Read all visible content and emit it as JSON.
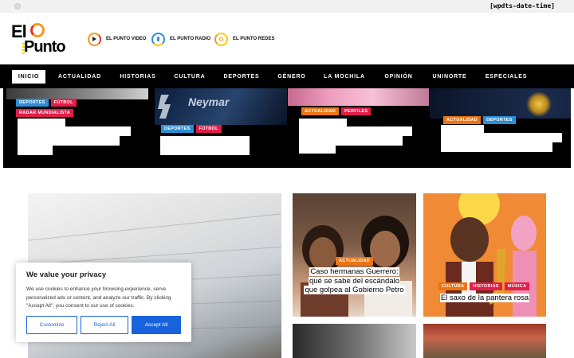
{
  "topbar": {
    "date_placeholder": "[wpdts-date-time]",
    "wp_icon": "wordpress-icon"
  },
  "brand": {
    "logo_line1": "El",
    "logo_line2": "Punto"
  },
  "media_links": [
    {
      "label": "EL PUNTO VIDEO",
      "icon": "play-icon"
    },
    {
      "label": "EL PUNTO RADIO",
      "icon": "microphone-icon"
    },
    {
      "label": "EL PUNTO REDES",
      "icon": "share-icon"
    }
  ],
  "nav": {
    "items": [
      "INICIO",
      "ACTUALIDAD",
      "HISTORIAS",
      "CULTURA",
      "DEPORTES",
      "GÉNERO",
      "LA MOCHILA",
      "OPINIÓN",
      "UNINORTE",
      "ESPECIALES"
    ],
    "active_index": 0
  },
  "featured": [
    {
      "tags": [
        "DEPORTES",
        "FÚTBOL",
        "RADAR MUNDIALISTA"
      ]
    },
    {
      "tags": [
        "DEPORTES",
        "FÚTBOL"
      ],
      "image_text": "Neymar"
    },
    {
      "tags": [
        "ACTUALIDAD",
        "PERFILES"
      ]
    },
    {
      "tags": [
        "ACTUALIDAD",
        "DEPORTES"
      ]
    }
  ],
  "cards": [
    {
      "tags": [
        "ACTUALIDAD"
      ],
      "title": "Caso hermanas Guerrero: qué se sabe del escándalo que golpea al Gobierno Petro"
    },
    {
      "tags": [
        "CULTURA",
        "HISTORIAS",
        "MÚSICA"
      ],
      "title": "El saxo de la pantera rosa"
    }
  ],
  "cookie": {
    "title": "We value your privacy",
    "text": "We use cookies to enhance your browsing experience, serve personalized ads or content, and analyze our traffic. By clicking \"Accept All\", you consent to our use of cookies.",
    "customize": "Customize",
    "reject": "Reject All",
    "accept": "Accept All"
  },
  "colors": {
    "nav_bg": "#000000",
    "deportes": "#2b8fd6",
    "futbol": "#e31d48",
    "actualidad": "#ee7411",
    "cookie_button": "#1863dc"
  }
}
